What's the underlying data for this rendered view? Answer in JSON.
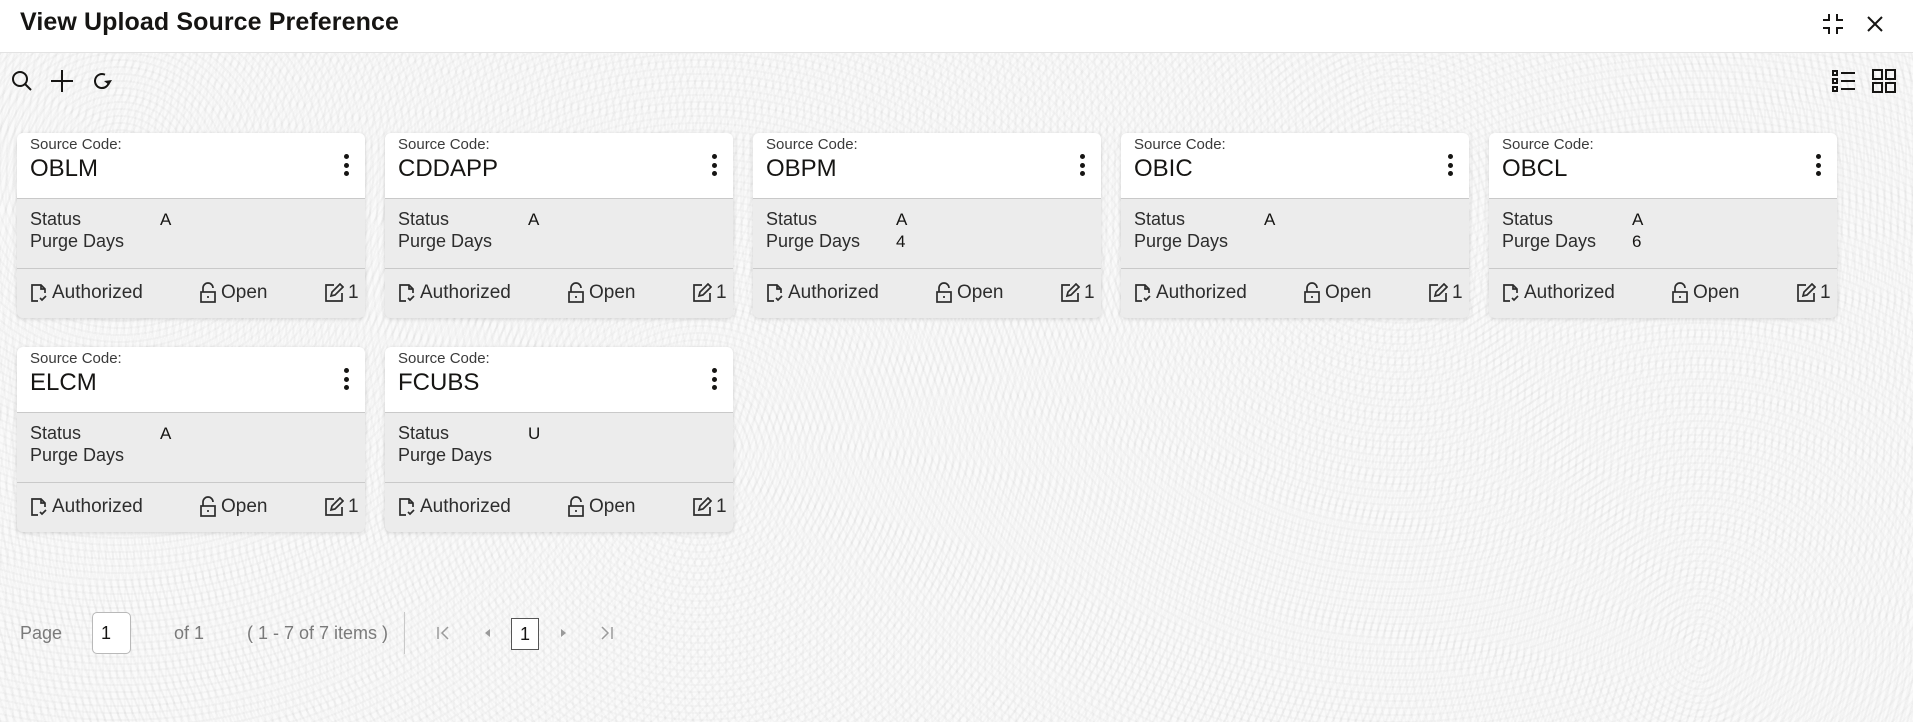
{
  "header": {
    "title": "View Upload Source Preference",
    "icons": [
      "minimize-icon",
      "close-icon"
    ]
  },
  "toolbar": {
    "left_icons": [
      "search-icon",
      "add-icon",
      "refresh-icon"
    ],
    "right_icons": [
      "list-view-icon",
      "grid-view-icon"
    ]
  },
  "cards": [
    {
      "source_code_label": "Source Code:",
      "source_code": "OBLM",
      "status_label": "Status",
      "status": "A",
      "purge_days_label": "Purge Days",
      "purge_days": "",
      "auth_status": "Authorized",
      "record_status": "Open",
      "mod_no": "1"
    },
    {
      "source_code_label": "Source Code:",
      "source_code": "CDDAPP",
      "status_label": "Status",
      "status": "A",
      "purge_days_label": "Purge Days",
      "purge_days": "",
      "auth_status": "Authorized",
      "record_status": "Open",
      "mod_no": "1"
    },
    {
      "source_code_label": "Source Code:",
      "source_code": "OBPM",
      "status_label": "Status",
      "status": "A",
      "purge_days_label": "Purge Days",
      "purge_days": "4",
      "auth_status": "Authorized",
      "record_status": "Open",
      "mod_no": "1"
    },
    {
      "source_code_label": "Source Code:",
      "source_code": "OBIC",
      "status_label": "Status",
      "status": "A",
      "purge_days_label": "Purge Days",
      "purge_days": "",
      "auth_status": "Authorized",
      "record_status": "Open",
      "mod_no": "1"
    },
    {
      "source_code_label": "Source Code:",
      "source_code": "OBCL",
      "status_label": "Status",
      "status": "A",
      "purge_days_label": "Purge Days",
      "purge_days": "6",
      "auth_status": "Authorized",
      "record_status": "Open",
      "mod_no": "1"
    },
    {
      "source_code_label": "Source Code:",
      "source_code": "ELCM",
      "status_label": "Status",
      "status": "A",
      "purge_days_label": "Purge Days",
      "purge_days": "",
      "auth_status": "Authorized",
      "record_status": "Open",
      "mod_no": "1"
    },
    {
      "source_code_label": "Source Code:",
      "source_code": "FCUBS",
      "status_label": "Status",
      "status": "U",
      "purge_days_label": "Purge Days",
      "purge_days": "",
      "auth_status": "Authorized",
      "record_status": "Open",
      "mod_no": "1"
    }
  ],
  "pagination": {
    "page_label": "Page",
    "page_value": "1",
    "of_label": "of 1",
    "range_label": "( 1 - 7 of 7 items )",
    "current_page": "1"
  }
}
